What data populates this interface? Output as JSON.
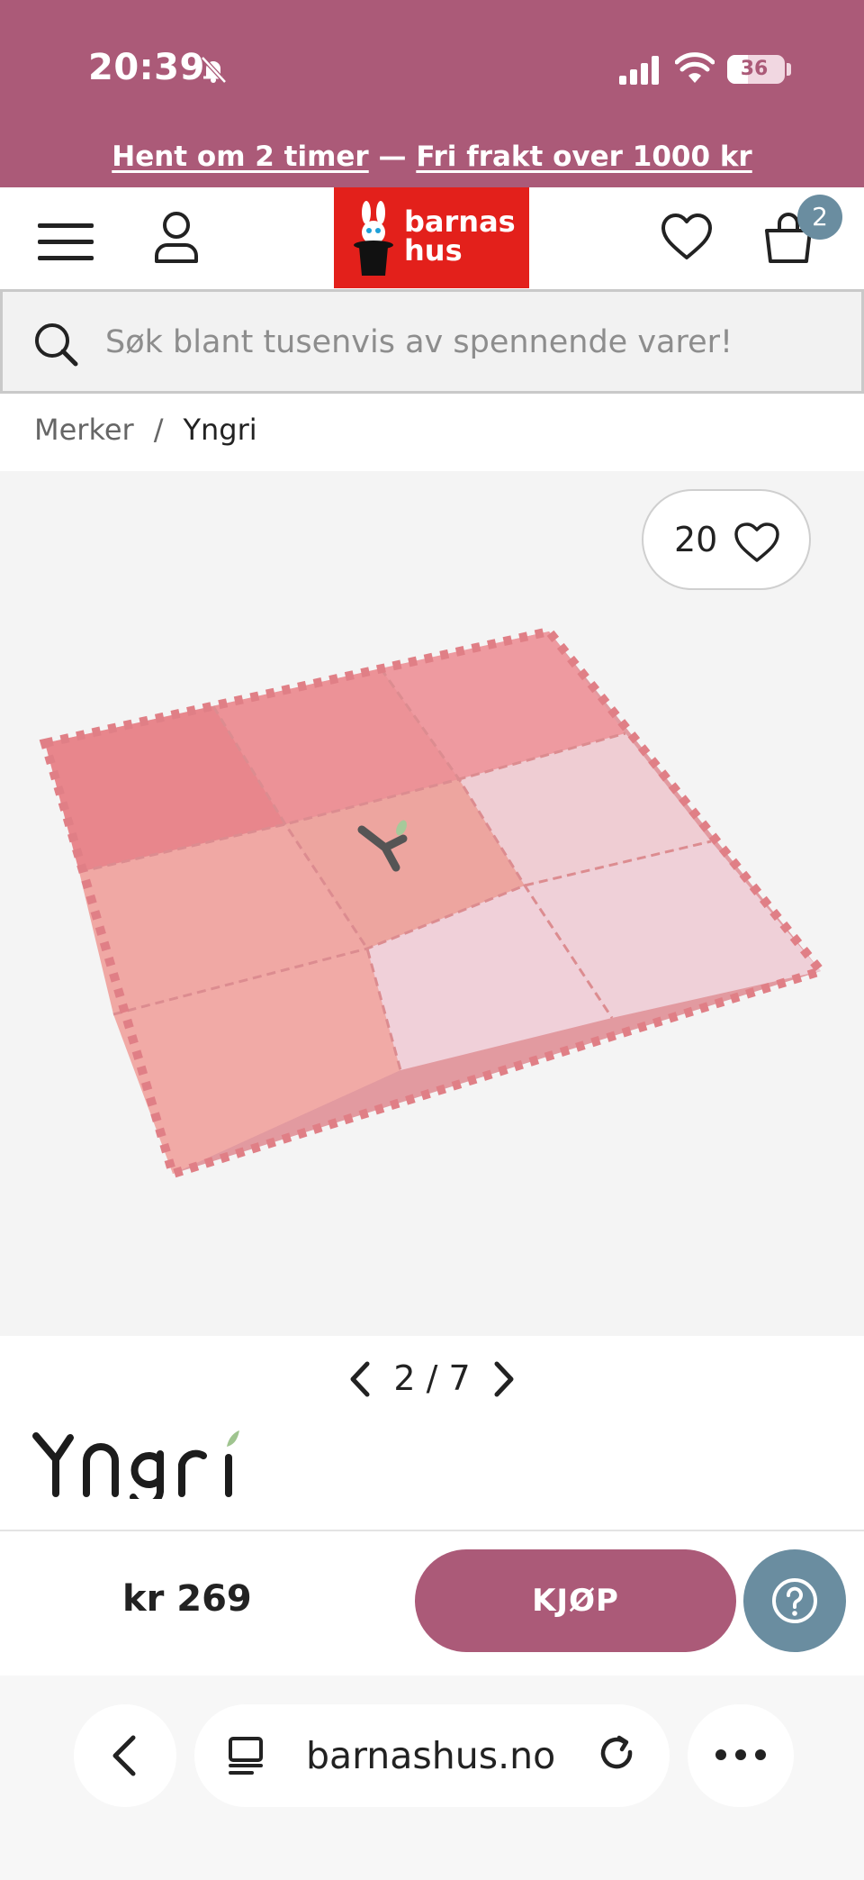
{
  "status_bar": {
    "time": "20:39",
    "battery": "36",
    "battery_level": 0.36,
    "icons": [
      "bell-slash-icon",
      "signal-icon",
      "wifi-icon",
      "battery-icon"
    ]
  },
  "promo": {
    "link1": "Hent om 2 timer",
    "separator": " — ",
    "link2": "Fri frakt over 1000 kr"
  },
  "header": {
    "logo_line1": "barnas",
    "logo_line2": "hus",
    "cart_count": "2",
    "icons": [
      "menu-icon",
      "user-icon",
      "heart-icon",
      "cart-icon"
    ]
  },
  "search": {
    "placeholder": "Søk blant tusenvis av spennende varer!"
  },
  "breadcrumb": {
    "items": [
      "Merker",
      "Yngri"
    ],
    "separator": "/"
  },
  "gallery": {
    "favorites_count": "20",
    "current": "2",
    "separator": "/",
    "total": "7"
  },
  "brand": {
    "name": "Yngri"
  },
  "buy": {
    "price": "kr 269",
    "button_label": "KJØP"
  },
  "browser": {
    "url": "barnashus.no"
  },
  "colors": {
    "brand_pink": "#ab5a78",
    "logo_red": "#e3201b",
    "help_blue": "#6a8da0"
  }
}
